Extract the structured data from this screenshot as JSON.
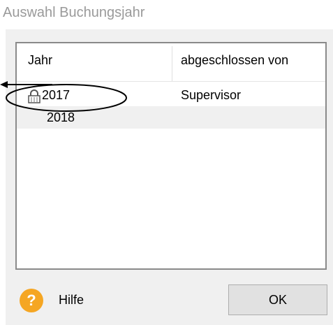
{
  "dialog": {
    "title": "Auswahl Buchungsjahr"
  },
  "list": {
    "columns": [
      {
        "label": "Jahr"
      },
      {
        "label": "abgeschlossen von"
      }
    ],
    "rows": [
      {
        "year": "2017",
        "closed_by": "Supervisor",
        "locked": true
      },
      {
        "year": "2018",
        "closed_by": "",
        "locked": false,
        "selected": true
      }
    ]
  },
  "footer": {
    "help_icon": "question-mark-icon",
    "help_icon_glyph": "?",
    "help_label": "Hilfe",
    "ok_label": "OK"
  },
  "colors": {
    "help_icon": "#f5a623",
    "selection": "#f0f0f0"
  }
}
